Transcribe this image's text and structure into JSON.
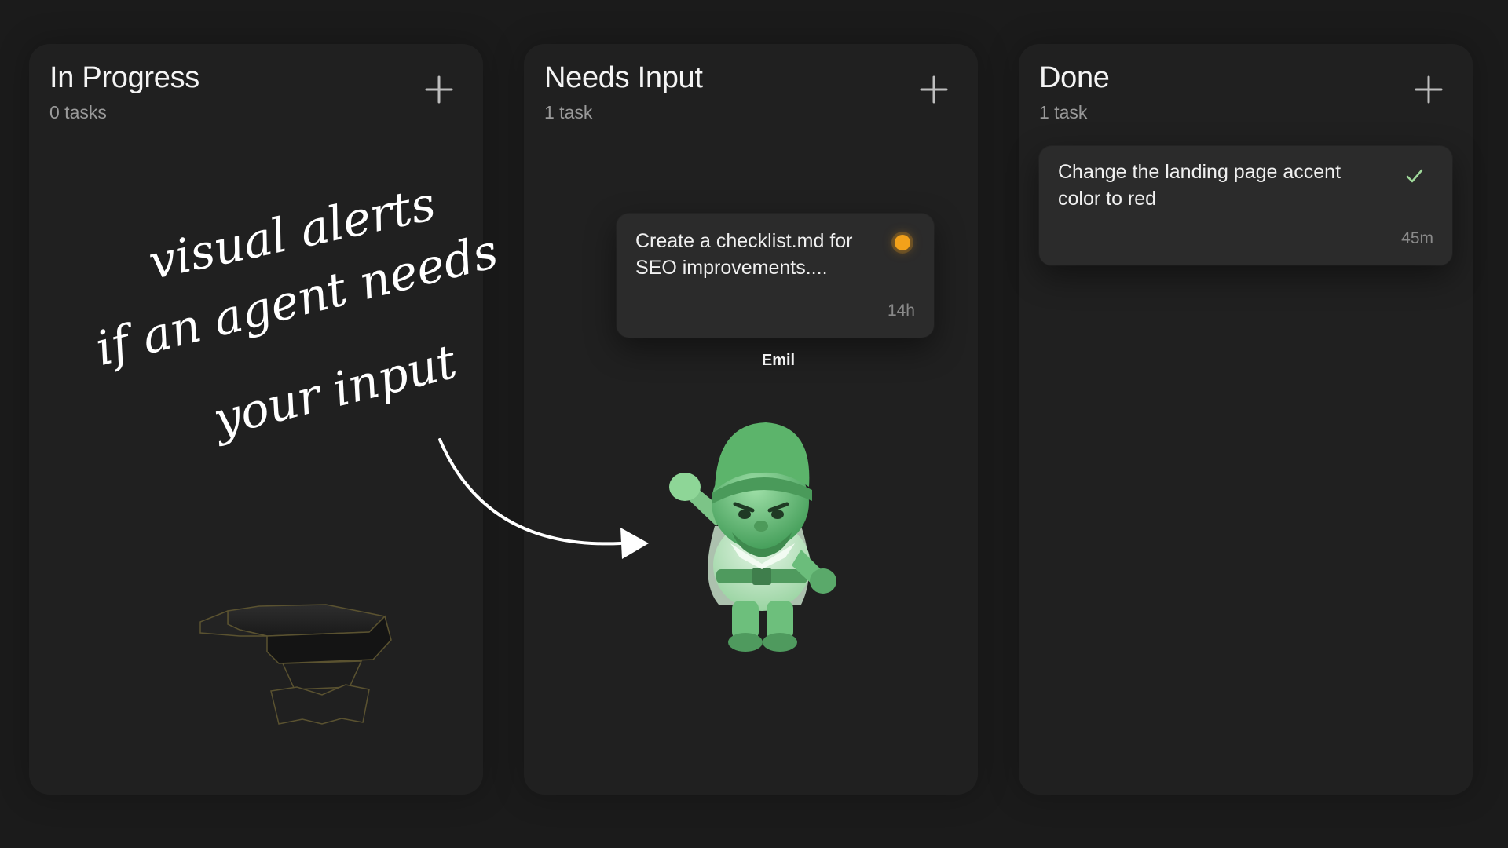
{
  "columns": [
    {
      "title": "In Progress",
      "count": "0 tasks"
    },
    {
      "title": "Needs Input",
      "count": "1 task"
    },
    {
      "title": "Done",
      "count": "1 task"
    }
  ],
  "needs_input_card": {
    "text": "Create a checklist.md for SEO improvements....",
    "time": "14h",
    "status_color": "#f2a11a",
    "agent": "Emil"
  },
  "done_card": {
    "text": "Change the landing page accent color to red",
    "time": "45m",
    "check_color": "#9fd89a"
  },
  "annotation": {
    "line1": "visual alerts",
    "line2": "if an agent needs",
    "line3": "your input"
  },
  "icons": {
    "add": "plus-icon",
    "status": "status-dot-icon",
    "done": "checkmark-icon",
    "anvil": "anvil-icon",
    "agent": "gnome-character-icon",
    "arrow": "curved-arrow-icon"
  },
  "colors": {
    "background": "#1b1b1b",
    "column": "#202020",
    "card": "#2b2b2b",
    "agent_green": "#5fbf72"
  }
}
